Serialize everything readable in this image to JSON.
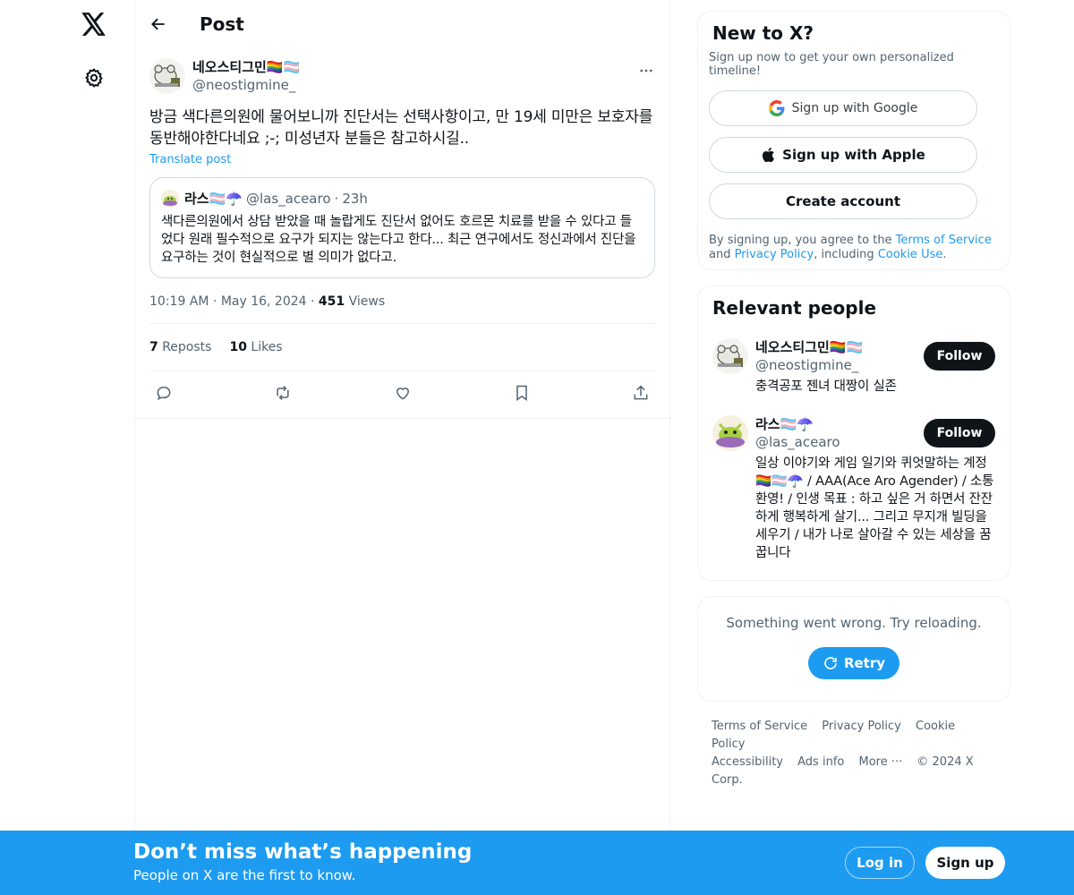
{
  "header": {
    "title": "Post"
  },
  "post": {
    "author": {
      "name": "네오스티그민🏳️‍🌈🏳️‍⚧️",
      "handle": "@neostigmine_"
    },
    "text": "방금 색다른의원에 물어보니까 진단서는 선택사항이고, 만 19세 미만은 보호자를 동반해야한다네요 ;-; 미성년자 분들은 참고하시길..",
    "translate_label": "Translate post",
    "quote": {
      "name": "라스🏳️‍⚧️☂️",
      "handle": "@las_acearo",
      "time": "23h",
      "text": "색다른의원에서 상담 받았을 때 놀랍게도 진단서 없어도 호르몬 치료를 받을 수 있다고 들었다 원래 필수적으로 요구가 되지는 않는다고 한다... 최근 연구에서도 정신과에서 진단을 요구하는 것이 현실적으로 별 의미가 없다고."
    },
    "timestamp": "10:19 AM",
    "date": "May 16, 2024",
    "views_count": "451",
    "views_label": "Views",
    "reposts_count": "7",
    "reposts_label": "Reposts",
    "likes_count": "10",
    "likes_label": "Likes"
  },
  "signup": {
    "title": "New to X?",
    "subtitle": "Sign up now to get your own personalized timeline!",
    "google_label": "Sign up with Google",
    "apple_label": "Sign up with Apple",
    "create_label": "Create account",
    "legal_prefix": "By signing up, you agree to the ",
    "terms_link": "Terms of Service",
    "legal_and": " and ",
    "privacy_link": "Privacy Policy",
    "legal_including": ", including ",
    "cookie_link": "Cookie Use",
    "legal_end": "."
  },
  "relevant": {
    "title": "Relevant people",
    "people": [
      {
        "name": "네오스티그민🏳️‍🌈🏳️‍⚧️",
        "handle": "@neostigmine_",
        "bio": "충격공포 젠녀 대짱이 실존",
        "follow_label": "Follow"
      },
      {
        "name": "라스🏳️‍⚧️☂️",
        "handle": "@las_acearo",
        "bio": "일상 이야기와 게임 일기와 퀴엇말하는 계정🏳️‍🌈🏳️‍⚧️☂️ / AAA(Ace Aro Agender) / 소통 환영! / 인생 목표 : 하고 싶은 거 하면서 잔잔하게 행복하게 살기... 그리고 무지개 빌딩을 세우기 / 내가 나로 살아갈 수 있는 세상을 꿈꿉니다",
        "follow_label": "Follow"
      }
    ]
  },
  "error": {
    "text": "Something went wrong. Try reloading.",
    "retry_label": "Retry"
  },
  "footer": {
    "links": [
      "Terms of Service",
      "Privacy Policy",
      "Cookie Policy",
      "Accessibility",
      "Ads info",
      "More ···",
      "© 2024 X Corp."
    ]
  },
  "banner": {
    "title": "Don’t miss what’s happening",
    "subtitle": "People on X are the first to know.",
    "login_label": "Log in",
    "signup_label": "Sign up"
  },
  "colors": {
    "accent": "#1d9bf0",
    "text": "#0f1419",
    "muted": "#536471",
    "border": "#eff3f4"
  }
}
